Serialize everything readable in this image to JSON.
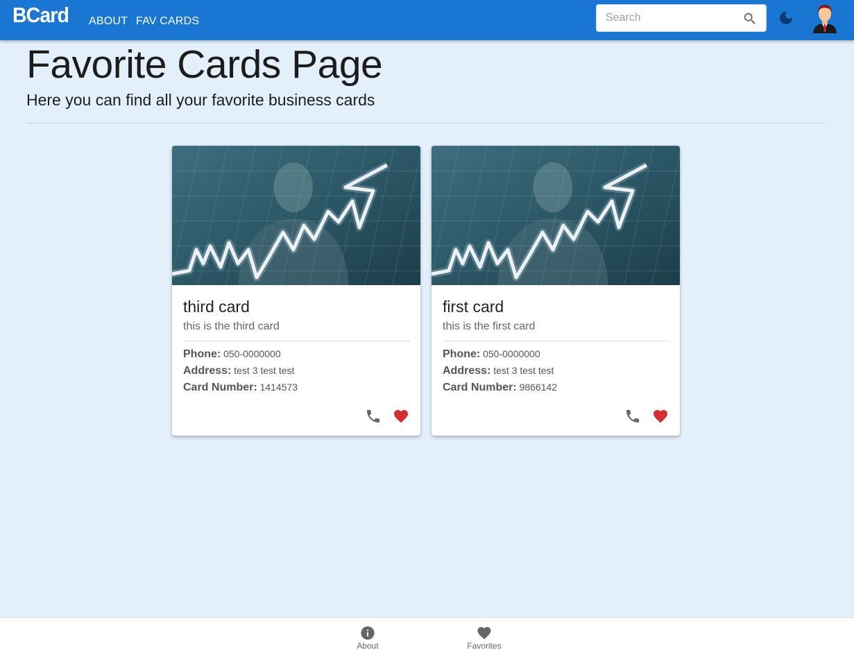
{
  "app": {
    "logo": "BCard",
    "nav": {
      "about": "ABOUT",
      "fav_cards": "FAV CARDS"
    },
    "search": {
      "placeholder": "Search",
      "value": ""
    },
    "icons": {
      "search": "search-icon",
      "theme_toggle": "moon-icon",
      "avatar": "user-avatar"
    },
    "colors": {
      "appbar": "#1976d2",
      "background": "#e3f0fb",
      "heart": "#d32f2f"
    }
  },
  "header": {
    "title": "Favorite Cards Page",
    "subtitle": "Here you can find all your favorite business cards"
  },
  "cards": [
    {
      "title": "third card",
      "subtitle": "this is the third card",
      "phone_label": "Phone:",
      "phone": "050-0000000",
      "address_label": "Address:",
      "address": "test 3 test test",
      "number_label": "Card Number:",
      "number": "1414573"
    },
    {
      "title": "first card",
      "subtitle": "this is the first card",
      "phone_label": "Phone:",
      "phone": "050-0000000",
      "address_label": "Address:",
      "address": "test 3 test test",
      "number_label": "Card Number:",
      "number": "9866142"
    }
  ],
  "bottom_nav": [
    {
      "label": "About",
      "icon": "info-icon"
    },
    {
      "label": "Favorites",
      "icon": "heart-icon"
    }
  ]
}
